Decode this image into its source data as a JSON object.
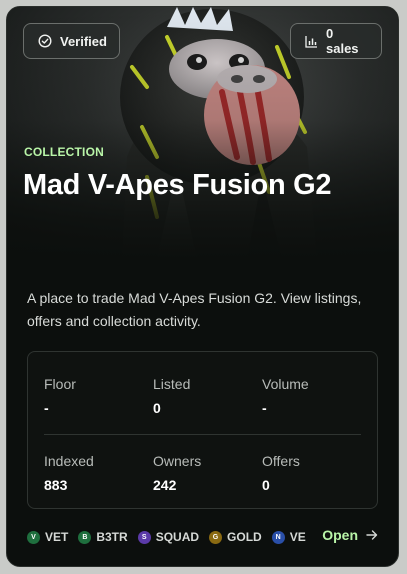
{
  "header": {
    "verified_label": "Verified",
    "sales_label": "0 sales"
  },
  "collection": {
    "kicker": "COLLECTION",
    "title": "Mad V-Apes Fusion G2",
    "description": "A place to trade Mad V-Apes Fusion G2. View listings, offers and collection activity."
  },
  "stats": [
    {
      "label": "Floor",
      "value": "-"
    },
    {
      "label": "Listed",
      "value": "0"
    },
    {
      "label": "Volume",
      "value": "-"
    },
    {
      "label": "Indexed",
      "value": "883"
    },
    {
      "label": "Owners",
      "value": "242"
    },
    {
      "label": "Offers",
      "value": "0"
    }
  ],
  "tokens": [
    {
      "letter": "V",
      "symbol": "VET",
      "color": "#1f6f3e"
    },
    {
      "letter": "B",
      "symbol": "B3TR",
      "color": "#1f6f3e"
    },
    {
      "letter": "S",
      "symbol": "SQUAD",
      "color": "#5b3aa8"
    },
    {
      "letter": "G",
      "symbol": "GOLD",
      "color": "#8a6a12"
    },
    {
      "letter": "N",
      "symbol": "VE",
      "color": "#2a4fa8"
    }
  ],
  "footer": {
    "open_label": "Open"
  },
  "colors": {
    "accent": "#b9f5a8",
    "card_bg": "#0c0f0d"
  }
}
